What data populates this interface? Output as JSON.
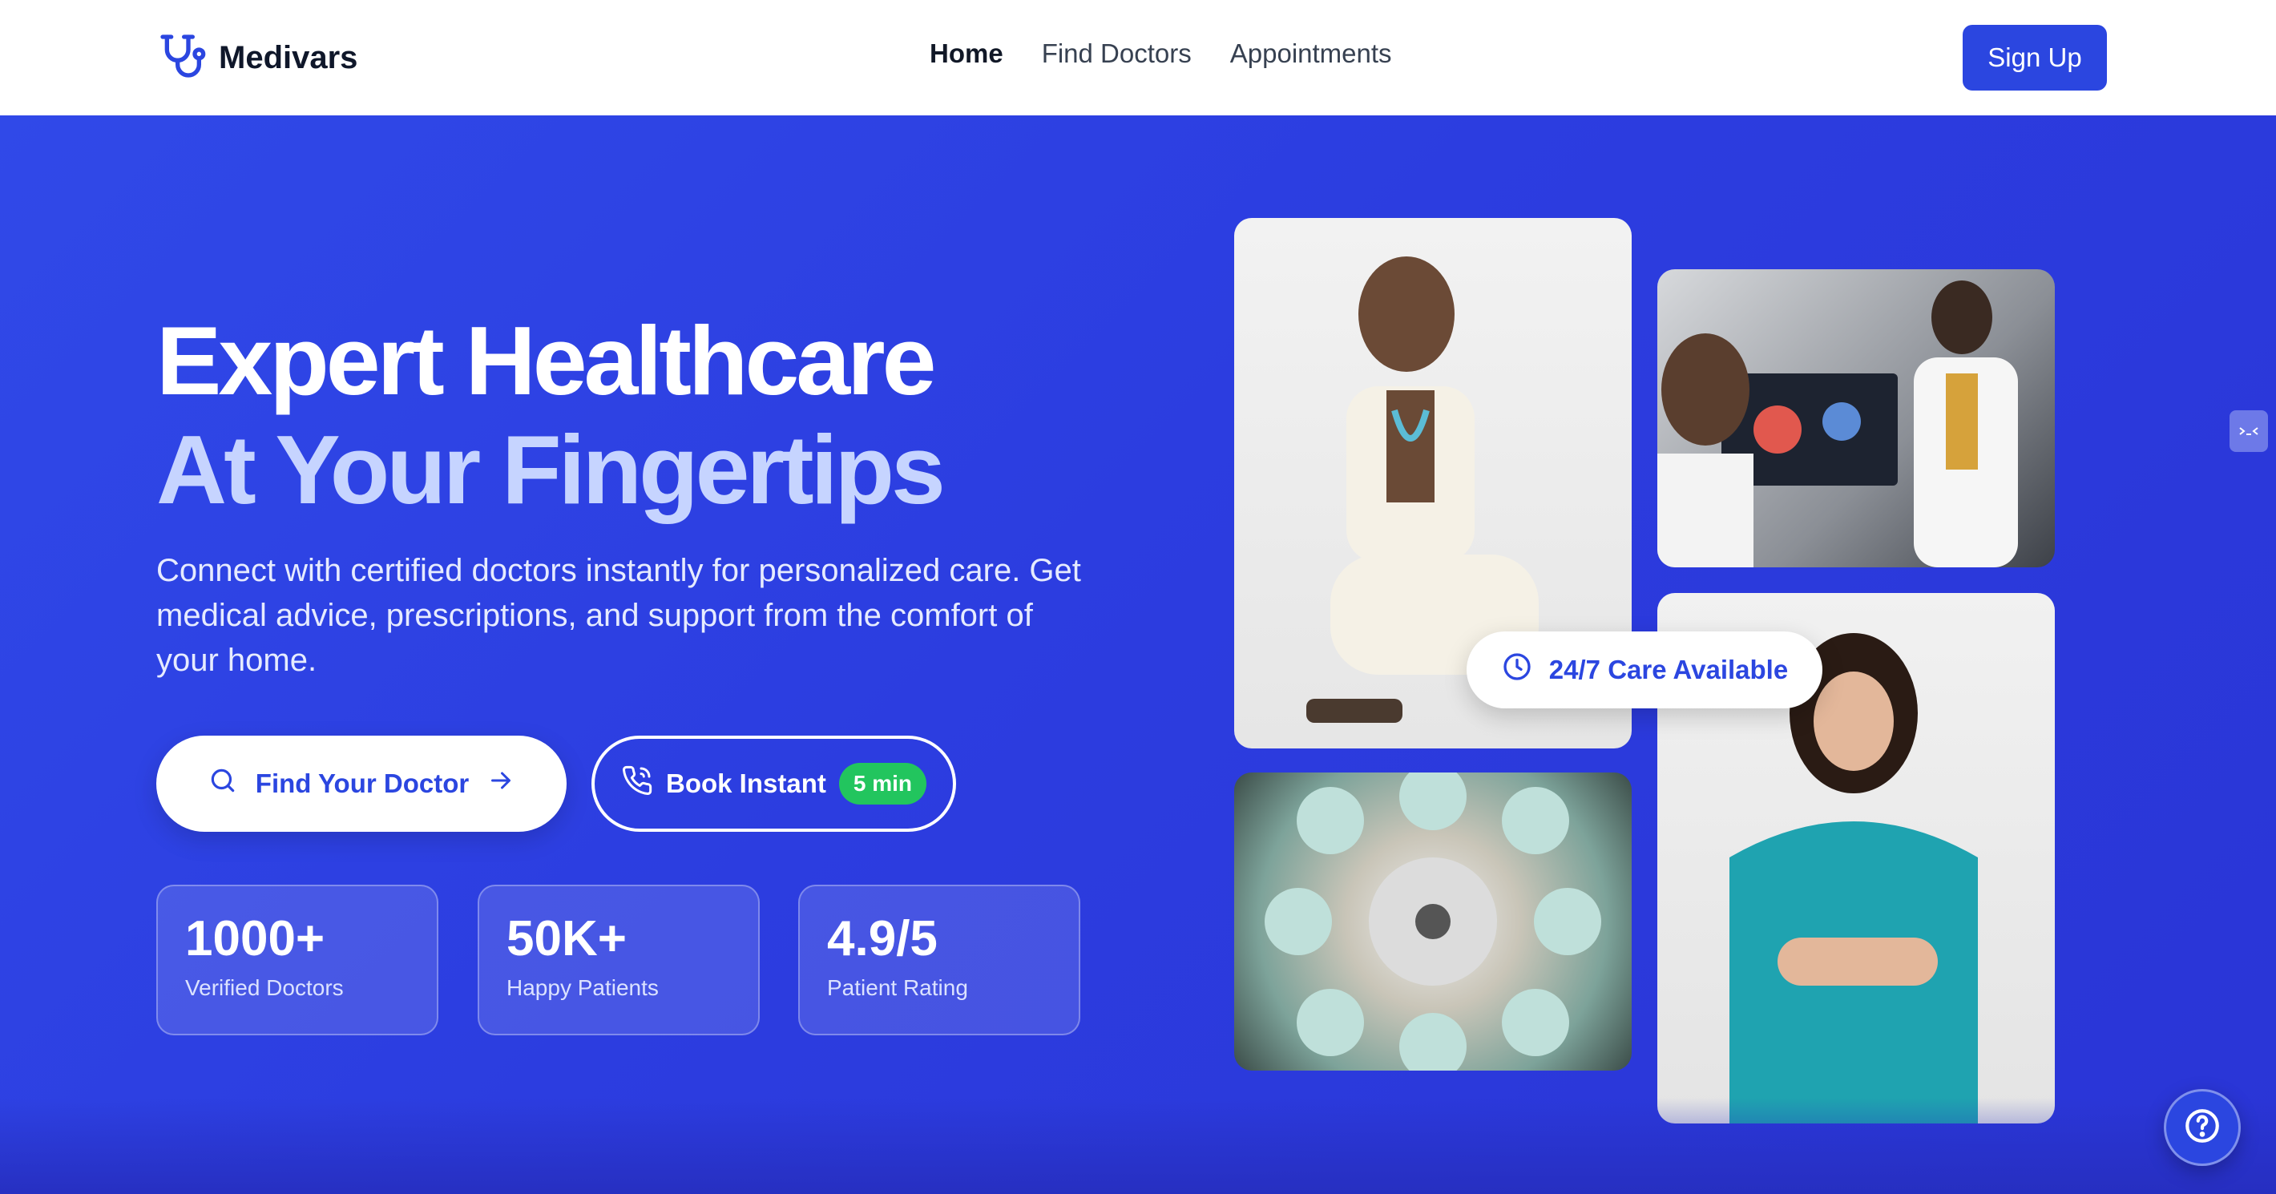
{
  "brand": {
    "name": "Medivars",
    "accent": "#2b46e0"
  },
  "nav": {
    "links": [
      {
        "label": "Home",
        "active": true
      },
      {
        "label": "Find Doctors",
        "active": false
      },
      {
        "label": "Appointments",
        "active": false
      }
    ],
    "signup_label": "Sign Up"
  },
  "hero": {
    "headline_line1": "Expert Healthcare",
    "headline_line2": "At Your Fingertips",
    "lead": "Connect with certified doctors instantly for personalized care. Get medical advice, prescriptions, and support from the comfort of your home.",
    "find_label": "Find Your Doctor",
    "book_label": "Book Instant",
    "book_badge": "5 min",
    "stats": [
      {
        "value": "1000+",
        "label": "Verified Doctors"
      },
      {
        "value": "50K+",
        "label": "Happy Patients"
      },
      {
        "value": "4.9/5",
        "label": "Patient Rating"
      }
    ],
    "care_badge": "24/7 Care Available"
  },
  "icons": {
    "logo": "stethoscope-icon",
    "find": "search-icon",
    "find_arrow": "arrow-right-icon",
    "book": "phone-call-icon",
    "care": "clock-icon",
    "help": "help-circle-icon"
  },
  "colors": {
    "hero_bg": "#2f4ae6",
    "badge_green": "#22c55e",
    "headline_light": "#c6d4ff"
  }
}
